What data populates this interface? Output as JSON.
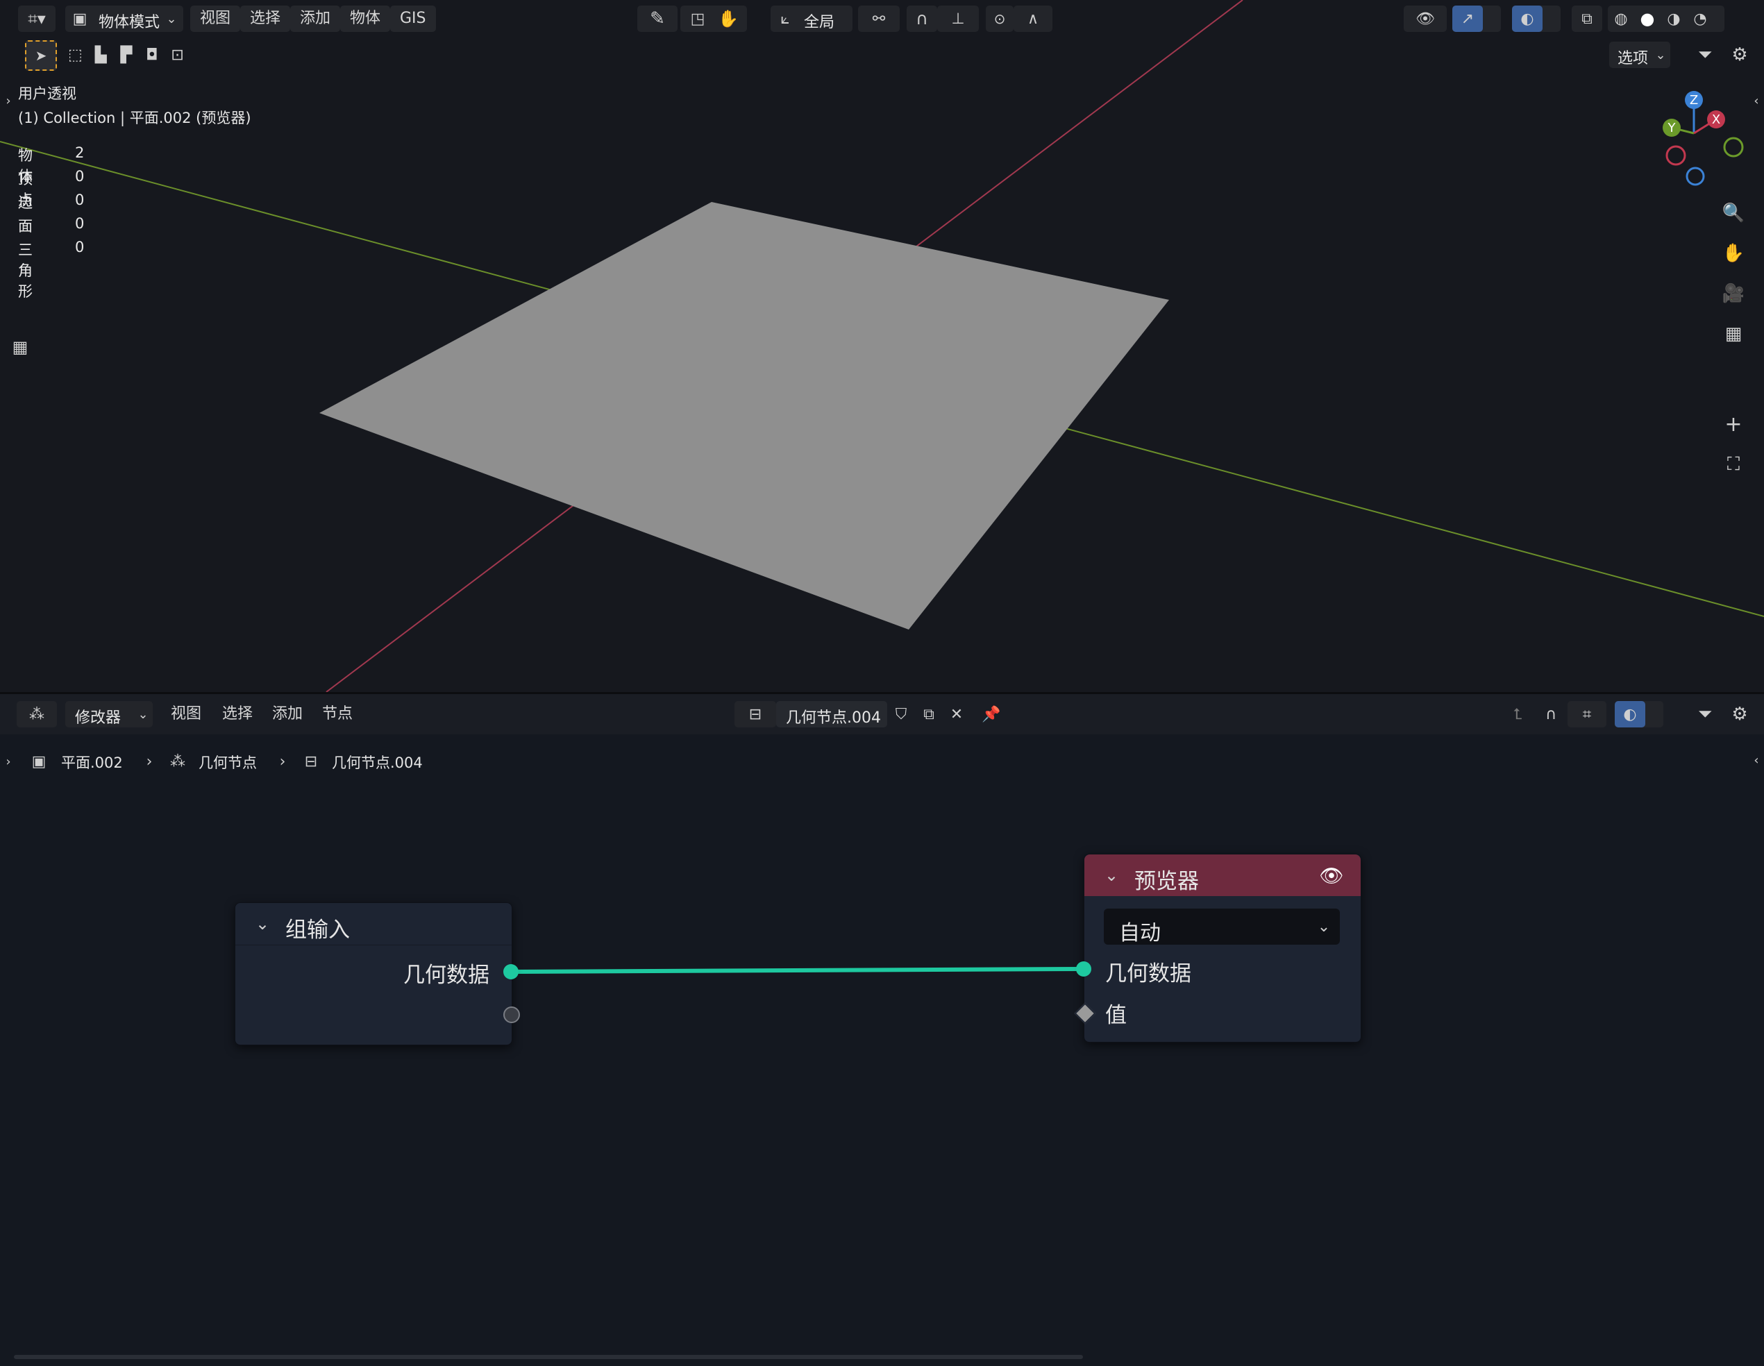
{
  "viewport": {
    "header": {
      "mode_label": "物体模式",
      "menus": [
        "视图",
        "选择",
        "添加",
        "物体",
        "GIS"
      ],
      "transform_orientation": "全局",
      "options_label": "选项"
    },
    "overlay": {
      "view_name": "用户透视",
      "collection_line": "(1) Collection | 平面.002 (预览器)",
      "stats": [
        {
          "label": "物体",
          "value": "2"
        },
        {
          "label": "顶点",
          "value": "0"
        },
        {
          "label": "边",
          "value": "0"
        },
        {
          "label": "面",
          "value": "0"
        },
        {
          "label": "三角形",
          "value": "0"
        }
      ]
    },
    "gizmo": {
      "z": "Z",
      "y": "Y",
      "x": "X"
    },
    "colors": {
      "x_axis": "#a1384f",
      "y_axis": "#6b8f2a",
      "plane": "#8f8f8f"
    }
  },
  "node_editor": {
    "header": {
      "editor_mode": "修改器",
      "menus": [
        "视图",
        "选择",
        "添加",
        "节点"
      ],
      "node_group_name": "几何节点.004"
    },
    "breadcrumb": [
      "平面.002",
      "几何节点",
      "几何节点.004"
    ],
    "nodes": {
      "group_input": {
        "title": "组输入",
        "output_label": "几何数据"
      },
      "viewer": {
        "title": "预览器",
        "domain_value": "自动",
        "input_geometry": "几何数据",
        "input_value": "值"
      }
    },
    "colors": {
      "link": "#1ec9a0",
      "viewer_header": "#6e2a3e",
      "node_body": "#1d2432"
    }
  }
}
